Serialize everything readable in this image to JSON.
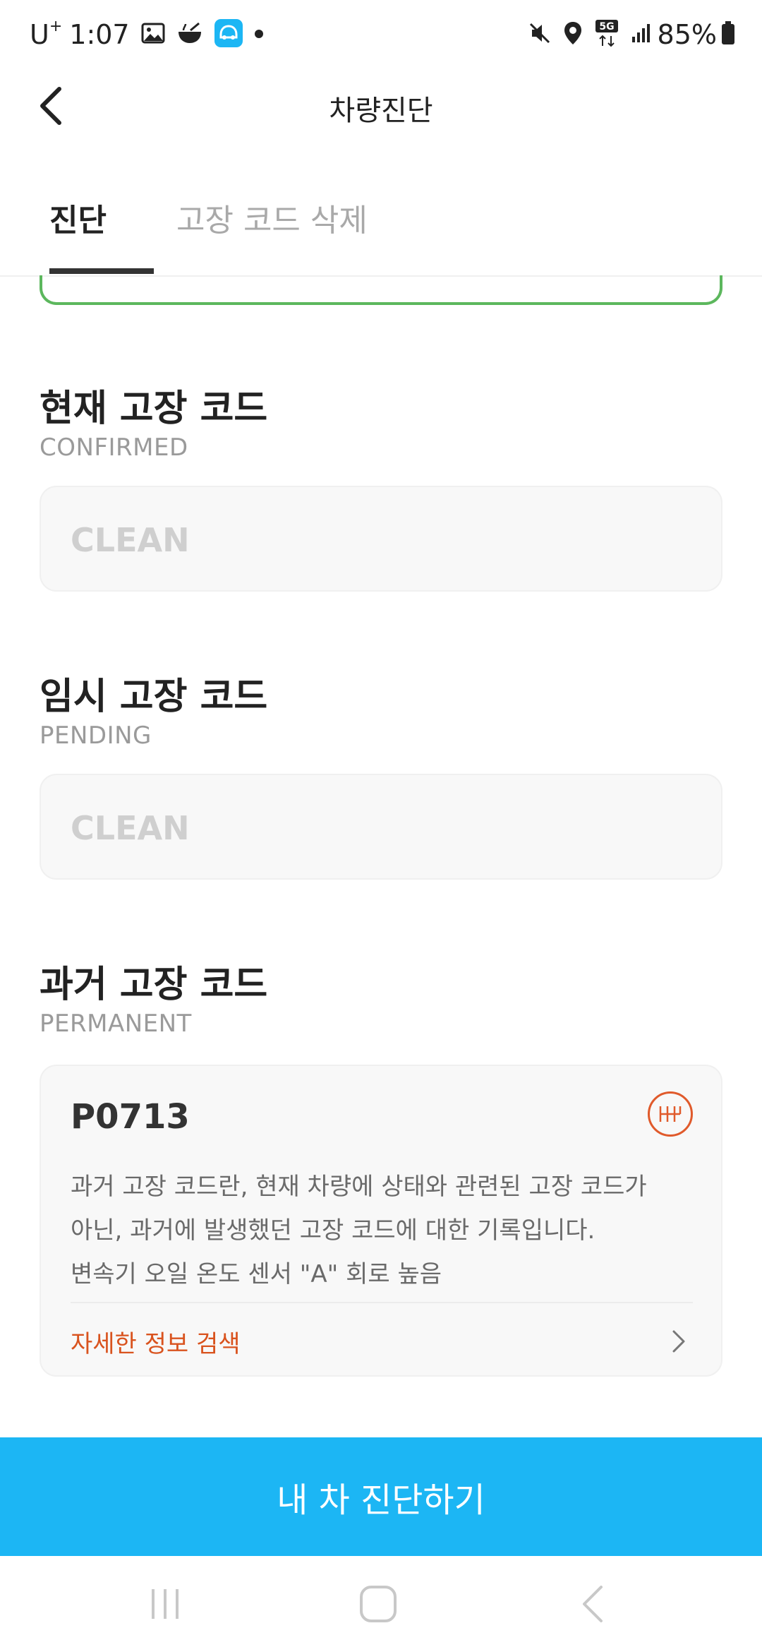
{
  "status_bar": {
    "carrier": "U",
    "carrier_sup": "+",
    "time": "1:07",
    "network": "5G",
    "battery": "85%"
  },
  "app_bar": {
    "title": "차량진단"
  },
  "tabs": [
    {
      "label": "진단",
      "active": true
    },
    {
      "label": "고장 코드 삭제",
      "active": false
    }
  ],
  "sections": {
    "confirmed": {
      "title": "현재 고장 코드",
      "subtitle": "CONFIRMED",
      "value": "CLEAN"
    },
    "pending": {
      "title": "임시 고장 코드",
      "subtitle": "PENDING",
      "value": "CLEAN"
    },
    "permanent": {
      "title": "과거 고장 코드",
      "subtitle": "PERMANENT",
      "code": "P0713",
      "description": [
        "과거 고장 코드란, 현재 차량에 상태와 관련된 고장 코드가",
        "아닌, 과거에 발생했던 고장 코드에 대한 기록입니다.",
        "변속기 오일 온도 센서 \"A\" 회로 높음"
      ],
      "link_label": "자세한 정보 검색",
      "icon": "gear-shift-icon"
    }
  },
  "cta": {
    "label": "내 차 진단하기"
  },
  "colors": {
    "accent": "#1cb6f4",
    "link": "#d9531e",
    "ok_border": "#5cb75d"
  }
}
